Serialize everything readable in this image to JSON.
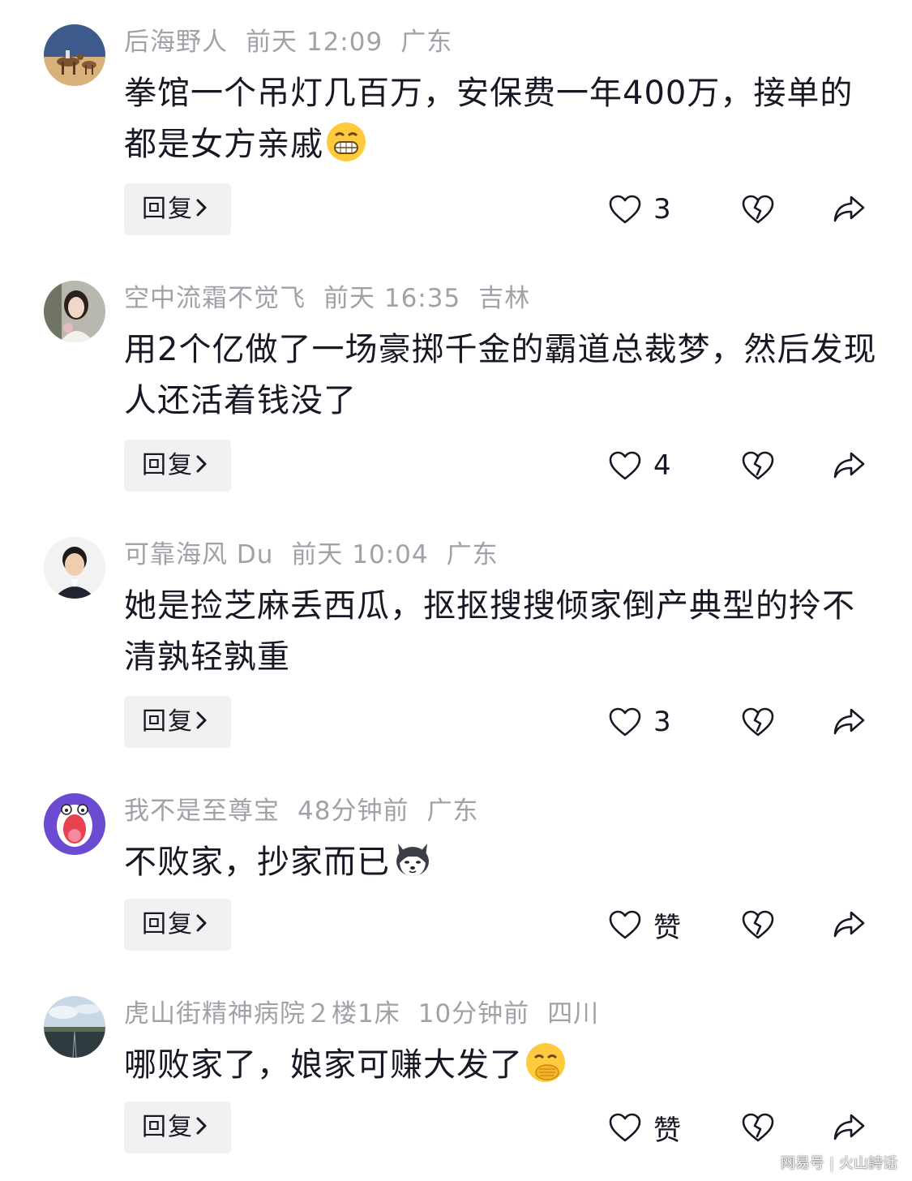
{
  "comments": [
    {
      "username": "后海野人",
      "time": "前天 12:09",
      "location": "广东",
      "text": "拳馆一个吊灯几百万，安保费一年400万，接单的都是女方亲戚",
      "emoji": "grinning-face-emoji",
      "reply_label": "回复",
      "likes": "3",
      "avatar": "desert-camel-rider-avatar"
    },
    {
      "username": "空中流霜不觉飞",
      "time": "前天 16:35",
      "location": "吉林",
      "text": "用2个亿做了一场豪掷千金的霸道总裁梦，然后发现人还活着钱没了",
      "emoji": "",
      "reply_label": "回复",
      "likes": "4",
      "avatar": "woman-portrait-avatar"
    },
    {
      "username": "可靠海风 Du",
      "time": "前天 10:04",
      "location": "广东",
      "text": "她是捡芝麻丢西瓜，抠抠搜搜倾家倒产典型的拎不清孰轻孰重",
      "emoji": "",
      "reply_label": "回复",
      "likes": "3",
      "avatar": "man-portrait-avatar"
    },
    {
      "username": "我不是至尊宝",
      "time": "48分钟前",
      "location": "广东",
      "text": "不败家，抄家而已",
      "emoji": "husky-dog-emoji",
      "reply_label": "回复",
      "likes": "赞",
      "avatar": "cartoon-screaming-face-avatar"
    },
    {
      "username": "虎山街精神病院２楼1床",
      "time": "10分钟前",
      "location": "四川",
      "text": "哪败家了，娘家可赚大发了",
      "emoji": "hand-over-mouth-emoji",
      "reply_label": "回复",
      "likes": "赞",
      "avatar": "sky-road-landscape-avatar"
    }
  ],
  "watermark": {
    "left": "网易号",
    "right": "火山詩话"
  },
  "colors": {
    "text": "#161823",
    "meta": "#a0a2a8",
    "button_bg": "#f1f1f2",
    "icon": "#161823"
  }
}
